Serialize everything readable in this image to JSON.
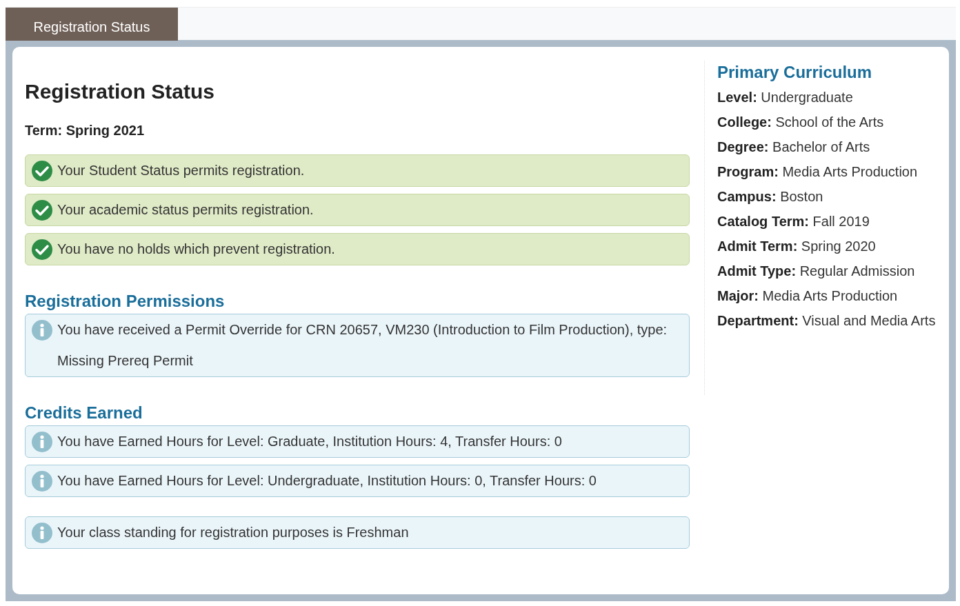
{
  "tabs": [
    {
      "label": "Registration Status",
      "selected": true
    }
  ],
  "main": {
    "title": "Registration Status",
    "term": "Term: Spring 2021",
    "sections": [
      {
        "messages": [
          {
            "kind": "success",
            "text": "Your Student Status permits registration."
          },
          {
            "kind": "success",
            "text": "Your academic status permits registration."
          },
          {
            "kind": "success",
            "text": "You have no holds which prevent registration."
          }
        ]
      },
      {
        "heading": "Registration Permissions",
        "messages": [
          {
            "kind": "info",
            "text": "You have received a Permit Override for CRN 20657, VM230 (Introduction to Film Production), type: Missing Prereq Permit"
          }
        ]
      },
      {
        "heading": "Credits Earned",
        "messages": [
          {
            "kind": "info",
            "text": "You have Earned Hours for Level: Graduate, Institution Hours: 4, Transfer Hours: 0"
          },
          {
            "kind": "info",
            "text": "You have Earned Hours for Level: Undergraduate, Institution Hours: 0, Transfer Hours: 0"
          }
        ]
      },
      {
        "messages": [
          {
            "kind": "info",
            "text": "Your class standing for registration purposes is Freshman"
          }
        ]
      }
    ]
  },
  "curriculum": {
    "heading": "Primary Curriculum",
    "items": [
      "**Level:** Undergraduate",
      "**College:** School of the Arts",
      "**Degree:** Bachelor of Arts",
      "**Program:** Media Arts Production",
      "**Campus:** Boston",
      "**Catalog Term:** Fall 2019",
      "**Admit Term:** Spring 2020",
      "**Admit Type:** Regular Admission",
      "**Major:** Media Arts Production",
      "**Department:** Visual and Media Arts"
    ]
  }
}
